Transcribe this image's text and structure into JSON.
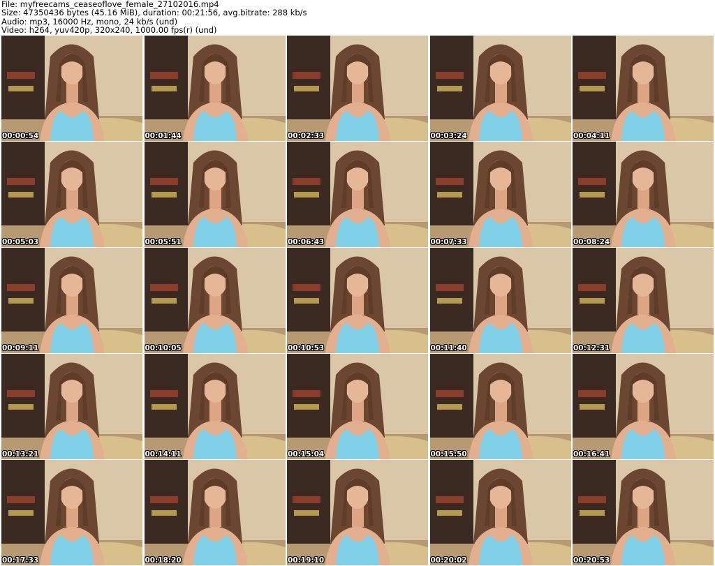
{
  "header": {
    "file_line": "File: myfreecams_ceaseoflove_female_27102016.mp4",
    "size_line": "Size: 47350436 bytes (45.16 MiB), duration: 00:21:56, avg.bitrate: 288 kb/s",
    "audio_line": "Audio: mp3, 16000 Hz, mono, 24 kb/s (und)",
    "video_line": "Video: h264, yuv420p, 320x240, 1000.00 fps(r) (und)"
  },
  "thumbnails": [
    {
      "timestamp": "00:00:54"
    },
    {
      "timestamp": "00:01:44"
    },
    {
      "timestamp": "00:02:33"
    },
    {
      "timestamp": "00:03:24"
    },
    {
      "timestamp": "00:04:11"
    },
    {
      "timestamp": "00:05:03"
    },
    {
      "timestamp": "00:05:51"
    },
    {
      "timestamp": "00:06:43"
    },
    {
      "timestamp": "00:07:33"
    },
    {
      "timestamp": "00:08:24"
    },
    {
      "timestamp": "00:09:11"
    },
    {
      "timestamp": "00:10:05"
    },
    {
      "timestamp": "00:10:53"
    },
    {
      "timestamp": "00:11:40"
    },
    {
      "timestamp": "00:12:31"
    },
    {
      "timestamp": "00:13:21"
    },
    {
      "timestamp": "00:14:11"
    },
    {
      "timestamp": "00:15:04"
    },
    {
      "timestamp": "00:15:50"
    },
    {
      "timestamp": "00:16:41"
    },
    {
      "timestamp": "00:17:33"
    },
    {
      "timestamp": "00:18:20"
    },
    {
      "timestamp": "00:19:10"
    },
    {
      "timestamp": "00:20:02"
    },
    {
      "timestamp": "00:20:53"
    }
  ],
  "colors": {
    "wall": "#d9c7a8",
    "dark_furniture": "#3a2a22",
    "floor": "#b89a72",
    "hair": "#6b4630",
    "skin": "#e2b08f",
    "top": "#7fd0e6"
  }
}
